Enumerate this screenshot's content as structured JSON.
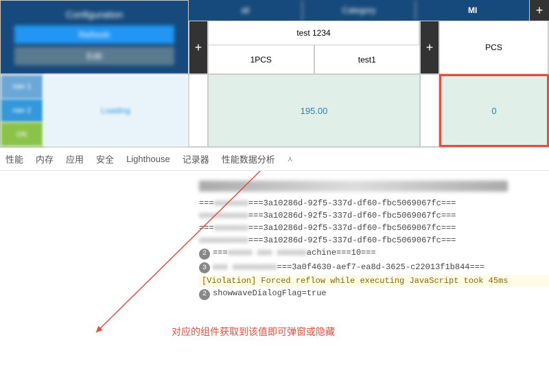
{
  "header": {
    "title": "Configuration",
    "btn1": "Refresh",
    "btn2": "Edit"
  },
  "sidebar": {
    "tab1": "nav 1",
    "tab2": "nav 2",
    "tab3": "OK",
    "content": "Loading"
  },
  "topTabs": {
    "t1": "all",
    "t2": "Category",
    "t3": "MI"
  },
  "grid": {
    "row1": "test 1234",
    "row2a": "1PCS",
    "row2b": "test1",
    "col2": "PCS",
    "val1": "195.00",
    "val2": "0"
  },
  "devtools": {
    "tabs": [
      "性能",
      "内存",
      "应用",
      "安全",
      "Lighthouse",
      "记录器",
      "性能数据分析"
    ],
    "guid": "3a10286d-92f5-337d-df60-fbc5069067fc",
    "guid2": "3a0f4630-aef7-ea8d-3625-c22013f1b844",
    "machine": "achine===10===",
    "violation": "[Violation] Forced reflow while executing JavaScript took 45ms",
    "flag": "showwaveDialogFlag=true",
    "badge2": "2",
    "badge3": "3"
  },
  "annotation": "对应的组件获取到该值即可弹窗或隐藏"
}
